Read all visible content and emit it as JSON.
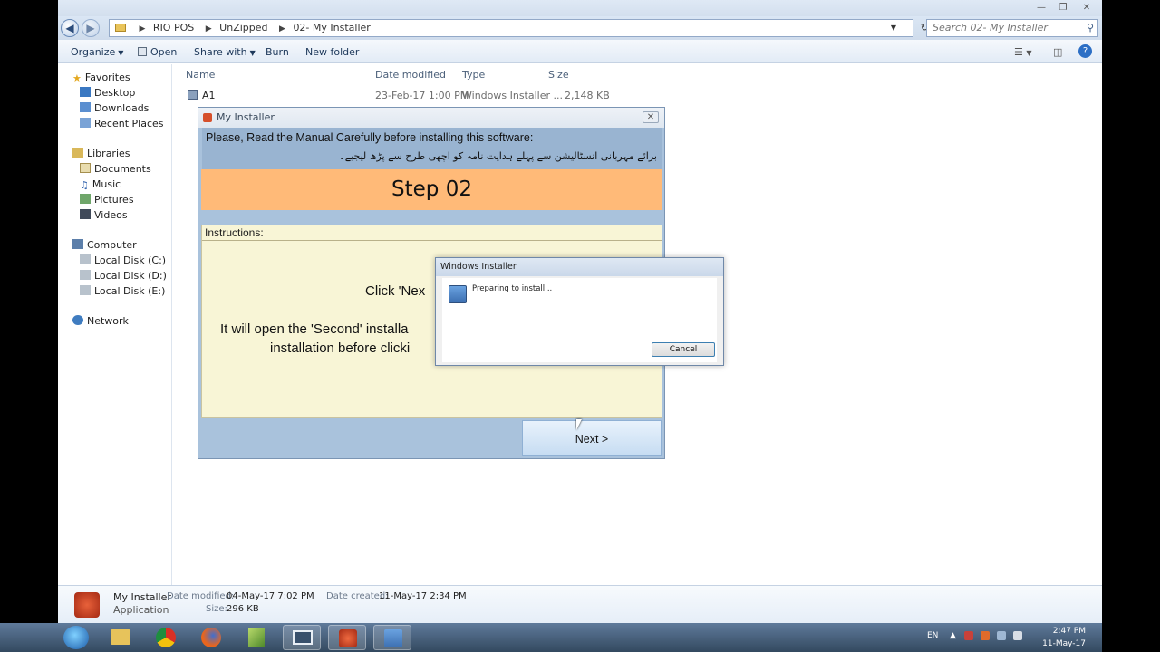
{
  "explorer": {
    "address": [
      "RIO POS",
      "UnZipped",
      "02- My Installer"
    ],
    "search_placeholder": "Search 02- My Installer",
    "toolbar": {
      "organize": "Organize",
      "open": "Open",
      "share_with": "Share with",
      "burn": "Burn",
      "new_folder": "New folder"
    },
    "nav": {
      "favorites": "Favorites",
      "desktop": "Desktop",
      "downloads": "Downloads",
      "recent_places": "Recent Places",
      "libraries": "Libraries",
      "documents": "Documents",
      "music": "Music",
      "pictures": "Pictures",
      "videos": "Videos",
      "computer": "Computer",
      "disk_c": "Local Disk (C:)",
      "disk_d": "Local Disk (D:)",
      "disk_e": "Local Disk (E:)",
      "network": "Network"
    },
    "columns": {
      "name": "Name",
      "date_modified": "Date modified",
      "type": "Type",
      "size": "Size"
    },
    "files": [
      {
        "name": "A1",
        "date": "23-Feb-17 1:00 PM",
        "type": "Windows Installer ...",
        "size": "2,148 KB"
      }
    ],
    "details": {
      "name": "My Installer",
      "kind": "Application",
      "date_modified_label": "Date modified:",
      "date_modified": "04-May-17 7:02 PM",
      "date_created_label": "Date created:",
      "date_created": "11-May-17 2:34 PM",
      "size_label": "Size:",
      "size": "296 KB"
    }
  },
  "installer": {
    "title": "My Installer",
    "manual_en": "Please, Read the Manual Carefully before installing this software:",
    "manual_ur": "برائے مہربانی انسٹالیشن سے پہلے ہدایت نامہ کو اچھی طرح سے پڑھ لیجیے۔",
    "step": "Step 02",
    "instructions_label": "Instructions:",
    "line1": "Click 'Nex",
    "line2": "It will open the 'Second' installa",
    "line3": "installation before clicki",
    "next_button": "Next >"
  },
  "windows_installer": {
    "title": "Windows Installer",
    "message": "Preparing to install...",
    "cancel": "Cancel"
  },
  "taskbar": {
    "language": "EN",
    "time": "2:47 PM",
    "date": "11-May-17"
  },
  "colors": {
    "step_banner": "#ffba78",
    "instructions_bg": "#f8f5d6",
    "installer_bg": "#a9c2dc",
    "taskbar": "#4a6280"
  }
}
